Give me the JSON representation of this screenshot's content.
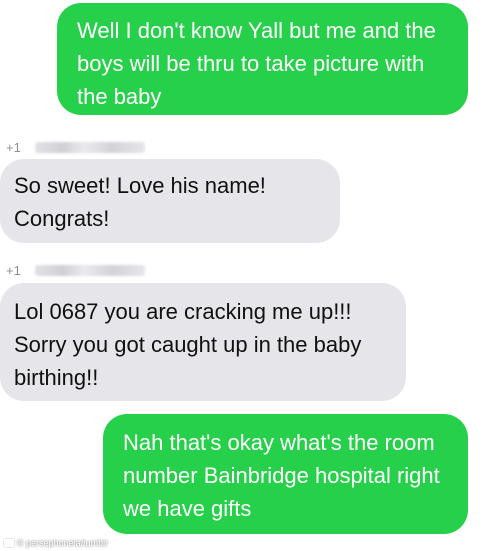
{
  "conversation": {
    "messages": [
      {
        "direction": "sent",
        "text": "Well I don't know Yall but me and the boys will be thru to take picture with the baby"
      },
      {
        "direction": "received",
        "sender": "+1",
        "text": "So sweet! Love his name! Congrats!"
      },
      {
        "direction": "received",
        "sender": "+1",
        "text": "Lol 0687 you are cracking me up!!! Sorry you got caught up in the baby birthing!!"
      },
      {
        "direction": "sent",
        "text": "Nah that's okay what's the room number Bainbridge hospital right we have gifts"
      }
    ]
  },
  "watermark": {
    "text": "© persephoneia/tumblr",
    "icon": "camera-icon"
  },
  "colors": {
    "sent_bubble": "#27d04a",
    "received_bubble": "#e5e5ea",
    "sender_label": "#8e8e93"
  }
}
